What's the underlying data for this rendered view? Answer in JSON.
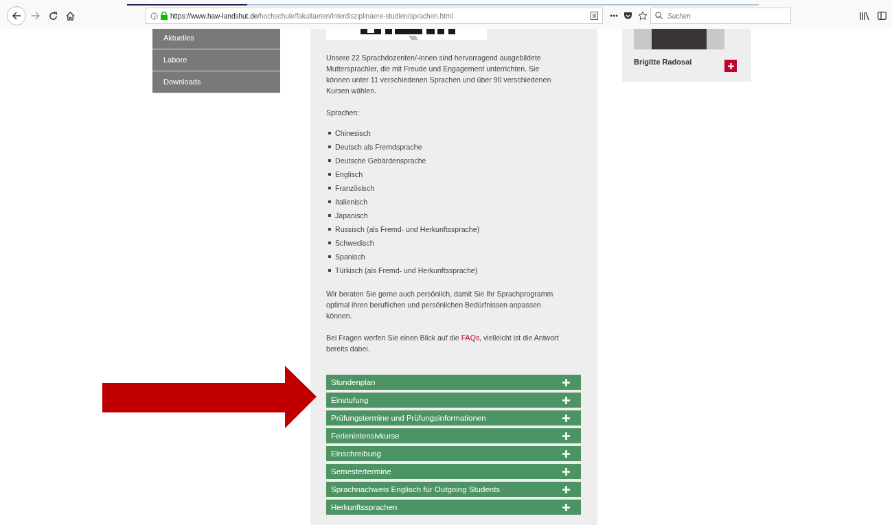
{
  "browser": {
    "url_host": "https://www.haw-landshut.de",
    "url_path": "/hochschule/fakultaeten/interdisziplinaere-studien/sprachen.html",
    "search_placeholder": "Suchen"
  },
  "sidebar": {
    "items": [
      {
        "label": "Aktuelles"
      },
      {
        "label": "Labore"
      },
      {
        "label": "Downloads"
      }
    ]
  },
  "content": {
    "intro": "Unsere 22 Sprachdozenten/-innen sind hervorragend ausgebildete Muttersprachler, die mit Freude und Engagement unterrichten. Sie können unter 11 verschiedenen Sprachen und über 90 verschiedenen Kursen wählen.",
    "languages_heading": "Sprachen:",
    "languages": [
      "Chinesisch",
      "Deutsch als Fremdsprache",
      "Deutsche Gebärdensprache",
      "Englisch",
      "Französisch",
      "Italienisch",
      "Japanisch",
      "Russisch (als Fremd- und Herkunftssprache)",
      "Schwedisch",
      "Spanisch",
      "Türkisch (als Fremd- und Herkunftssprache)"
    ],
    "advice": "Wir beraten Sie gerne auch  persönlich, damit Sie Ihr Sprachprogramm optimal ihren beruflichen und persönlichen Bedürfnissen anpassen können.",
    "faq": {
      "before": "Bei Fragen werfen Sie einen Blick auf die ",
      "link": "FAQs",
      "after": ", vielleicht ist die Antwort bereits dabei."
    },
    "accordion": [
      {
        "label": "Stundenplan",
        "expanded": false
      },
      {
        "label": "Einstufung",
        "expanded": false
      },
      {
        "label": "Prüfungstermine und Prüfungsinformationen",
        "expanded": false
      },
      {
        "label": "Ferienintensivkurse",
        "expanded": false
      },
      {
        "label": "Einschreibung",
        "expanded": false
      },
      {
        "label": "Semestertermine",
        "expanded": false
      },
      {
        "label": "Sprachnachweis Englisch für Outgoing Students",
        "expanded": false
      },
      {
        "label": "Herkunftssprachen",
        "expanded": false
      }
    ]
  },
  "contact": {
    "name": "Brigitte Radosai"
  }
}
